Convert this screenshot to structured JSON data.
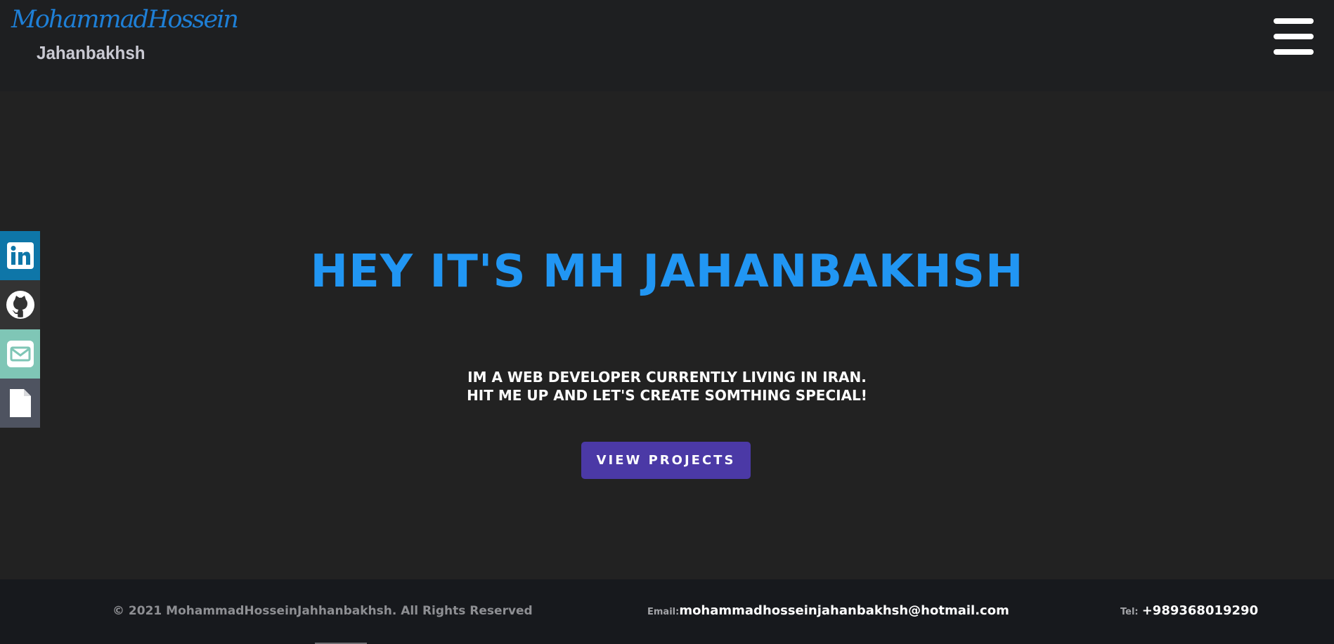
{
  "header": {
    "logo_script": "MohammadHossein",
    "logo_text": "Jahanbakhsh",
    "menu_icon": "hamburger-icon"
  },
  "social": [
    {
      "name": "linkedin",
      "icon": "linkedin-icon",
      "color": "#0e76a8"
    },
    {
      "name": "github",
      "icon": "github-icon",
      "color": "#333333"
    },
    {
      "name": "email",
      "icon": "envelope-icon",
      "color": "#7fc6b6"
    },
    {
      "name": "resume",
      "icon": "document-icon",
      "color": "#4e5360"
    }
  ],
  "hero": {
    "title": "HEY IT'S MH JAHANBAKHSH",
    "line1": "IM A WEB DEVELOPER CURRENTLY LIVING IN IRAN.",
    "line2": "HIT ME UP AND LET'S CREATE SOMTHING SPECIAL!",
    "button": "VIEW PROJECTS"
  },
  "footer": {
    "copyright": "© 2021 MohammadHosseinJahhanbakhsh. All Rights Reserved",
    "email_label": "Email:",
    "email": "mohammadhosseinjahanbakhsh@hotmail.com",
    "tel_label": "Tel:",
    "tel": "+989368019290"
  },
  "colors": {
    "accent": "#2196f3",
    "button": "#4b39a6",
    "background": "#222222",
    "header": "#1e1f21",
    "footer": "#17191d"
  }
}
